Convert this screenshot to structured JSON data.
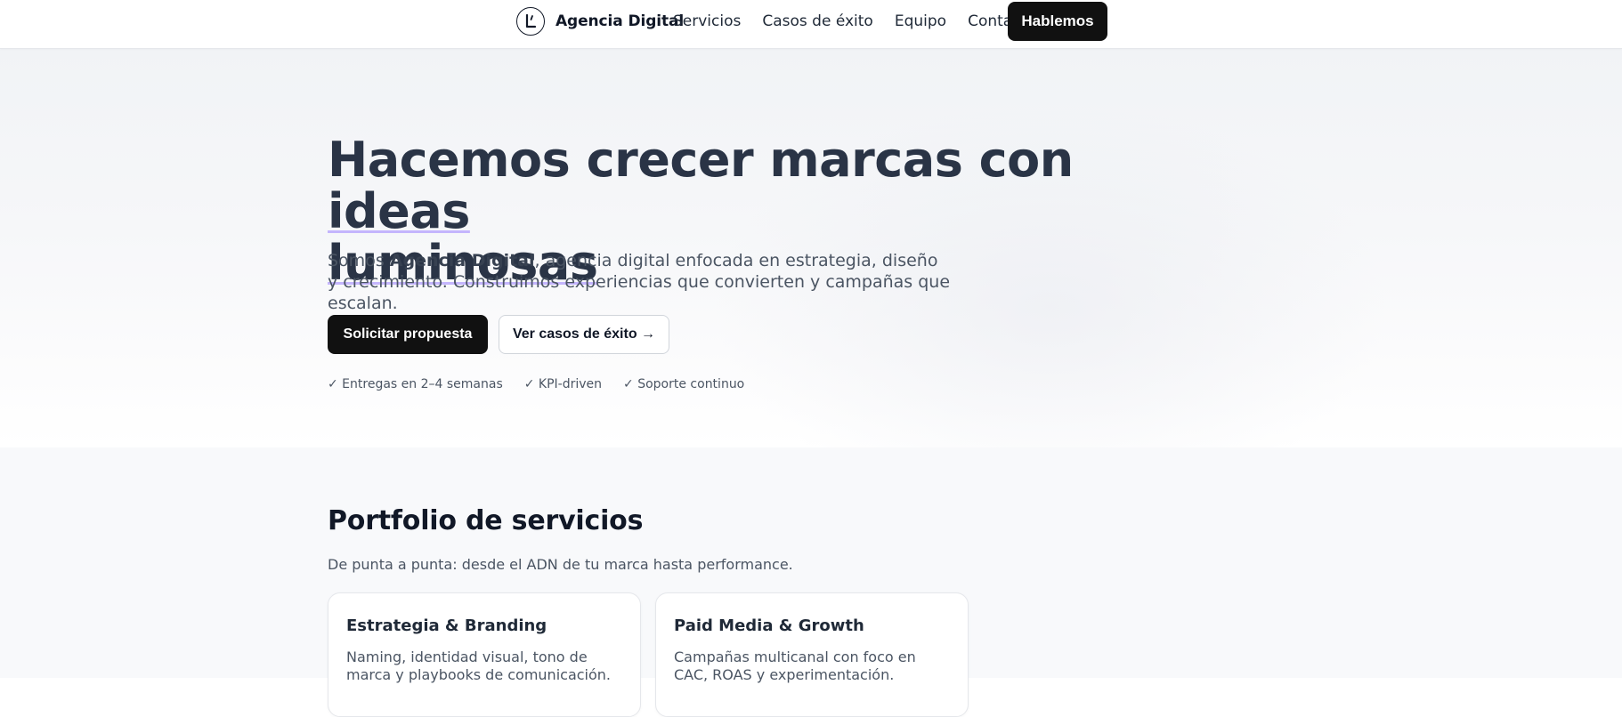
{
  "header": {
    "brand_name": "Agencia Digital",
    "nav": [
      {
        "label": "Servicios"
      },
      {
        "label": "Casos de éxito"
      },
      {
        "label": "Equipo"
      },
      {
        "label": "Contacto"
      }
    ],
    "cta_label": "Hablemos"
  },
  "hero": {
    "title_part1": "Hacemos crecer marcas con ",
    "title_highlight1": "ideas",
    "title_highlight2": "luminosas",
    "sub_prefix": "Somos ",
    "sub_brand": "Agencia Digital",
    "sub_suffix": ", agencia digital enfocada en estrategia, diseño y crecimiento. Construimos experiencias que convierten y campañas que escalan.",
    "primary_button": "Solicitar propuesta",
    "secondary_button": "Ver casos de éxito →",
    "perks": [
      "✓ Entregas en 2–4 semanas",
      "✓ KPI-driven",
      "✓ Soporte continuo"
    ]
  },
  "portfolio": {
    "title": "Portfolio de servicios",
    "subtitle": "De punta a punta: desde el ADN de tu marca hasta performance.",
    "cards": [
      {
        "title": "Estrategia & Branding",
        "desc": "Naming, identidad visual, tono de marca y playbooks de comunicación."
      },
      {
        "title": "Paid Media & Growth",
        "desc": "Campañas multicanal con foco en CAC, ROAS y experimentación."
      }
    ]
  },
  "colors": {
    "accent_underline": "#c4b5fd",
    "primary_button": "#111111",
    "heading": "#2a3446"
  },
  "icons": {
    "logo": "brand-logo-icon"
  }
}
